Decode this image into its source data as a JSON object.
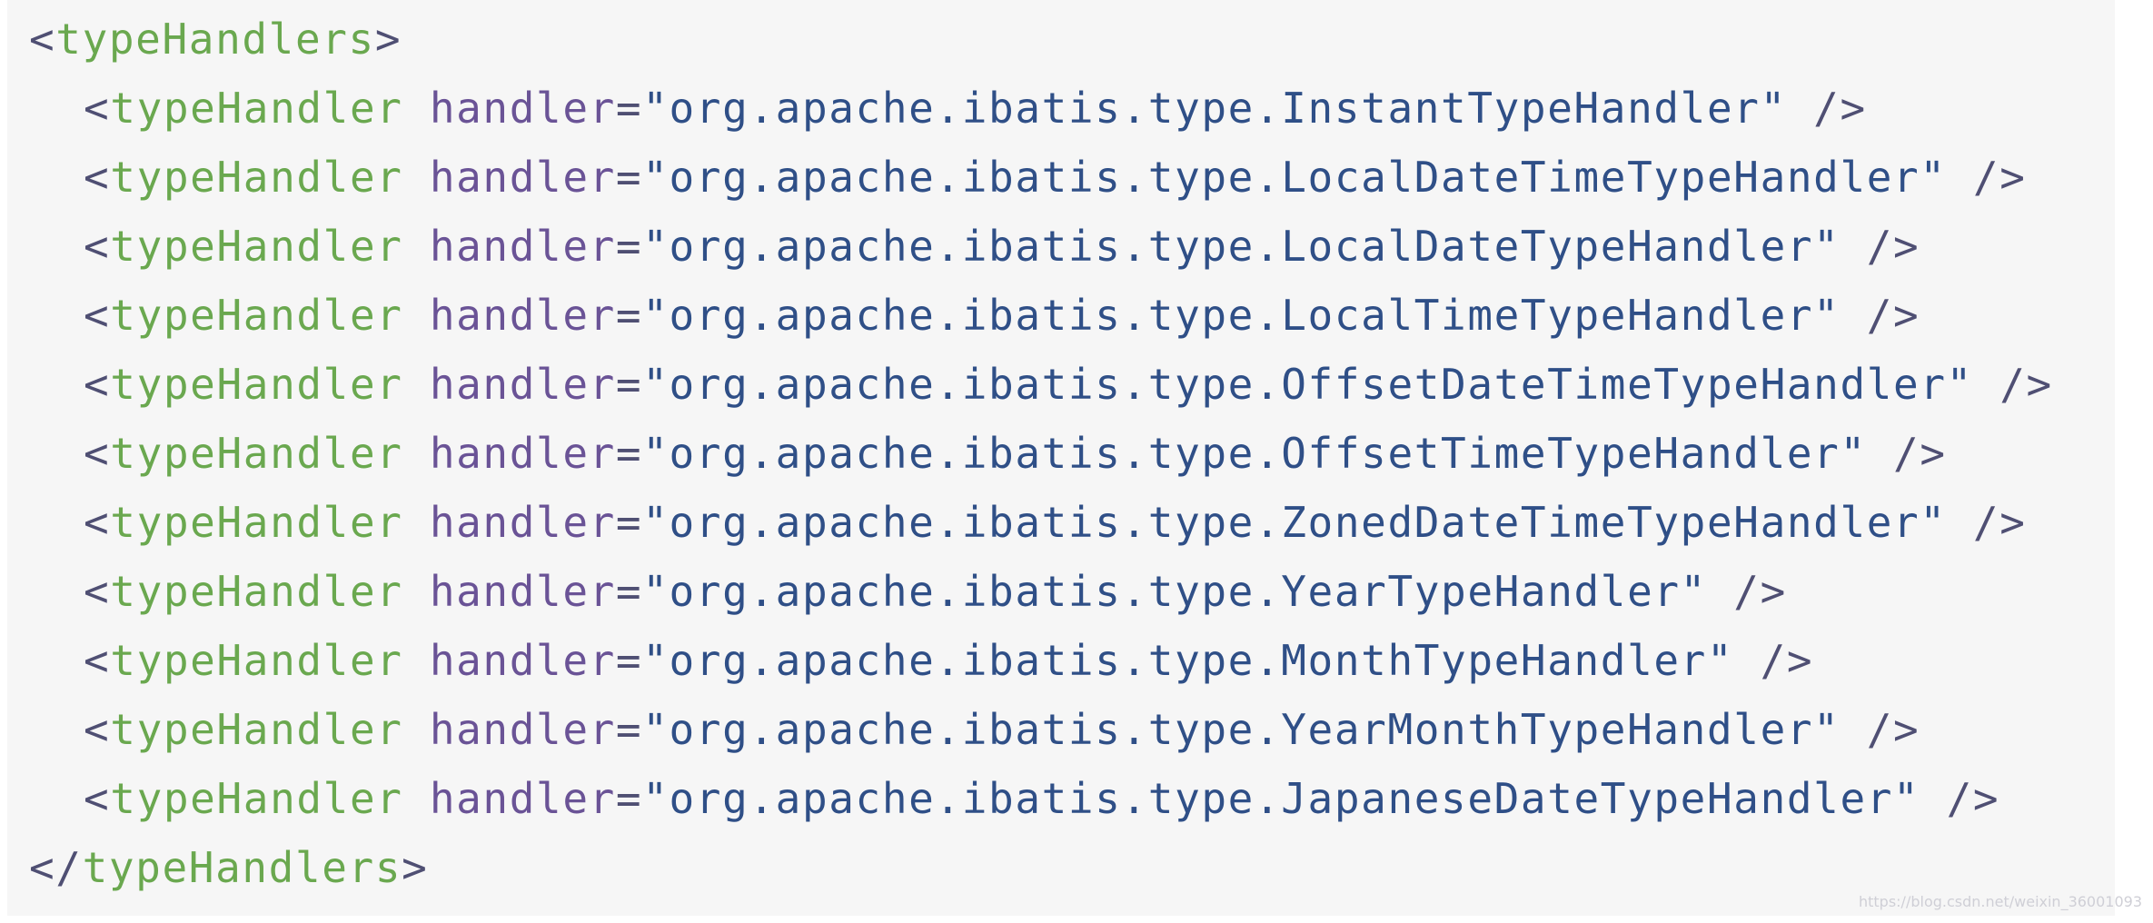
{
  "code": {
    "open_tag_bracket": "<",
    "root_tag": "typeHandlers",
    "close_bracket": ">",
    "close_tag_prefix": "</",
    "child_tag": "typeHandler",
    "attr_name": "handler",
    "equals": "=",
    "self_close": " />",
    "handlers": [
      "\"org.apache.ibatis.type.InstantTypeHandler\"",
      "\"org.apache.ibatis.type.LocalDateTimeTypeHandler\"",
      "\"org.apache.ibatis.type.LocalDateTypeHandler\"",
      "\"org.apache.ibatis.type.LocalTimeTypeHandler\"",
      "\"org.apache.ibatis.type.OffsetDateTimeTypeHandler\"",
      "\"org.apache.ibatis.type.OffsetTimeTypeHandler\"",
      "\"org.apache.ibatis.type.ZonedDateTimeTypeHandler\"",
      "\"org.apache.ibatis.type.YearTypeHandler\"",
      "\"org.apache.ibatis.type.MonthTypeHandler\"",
      "\"org.apache.ibatis.type.YearMonthTypeHandler\"",
      "\"org.apache.ibatis.type.JapaneseDateTypeHandler\""
    ]
  },
  "watermark": "https://blog.csdn.net/weixin_36001093",
  "colors": {
    "background": "#f6f6f6",
    "tag": "#6aa84f",
    "attribute": "#6a5396",
    "string": "#2f4f87",
    "punctuation": "#4f4f73"
  }
}
